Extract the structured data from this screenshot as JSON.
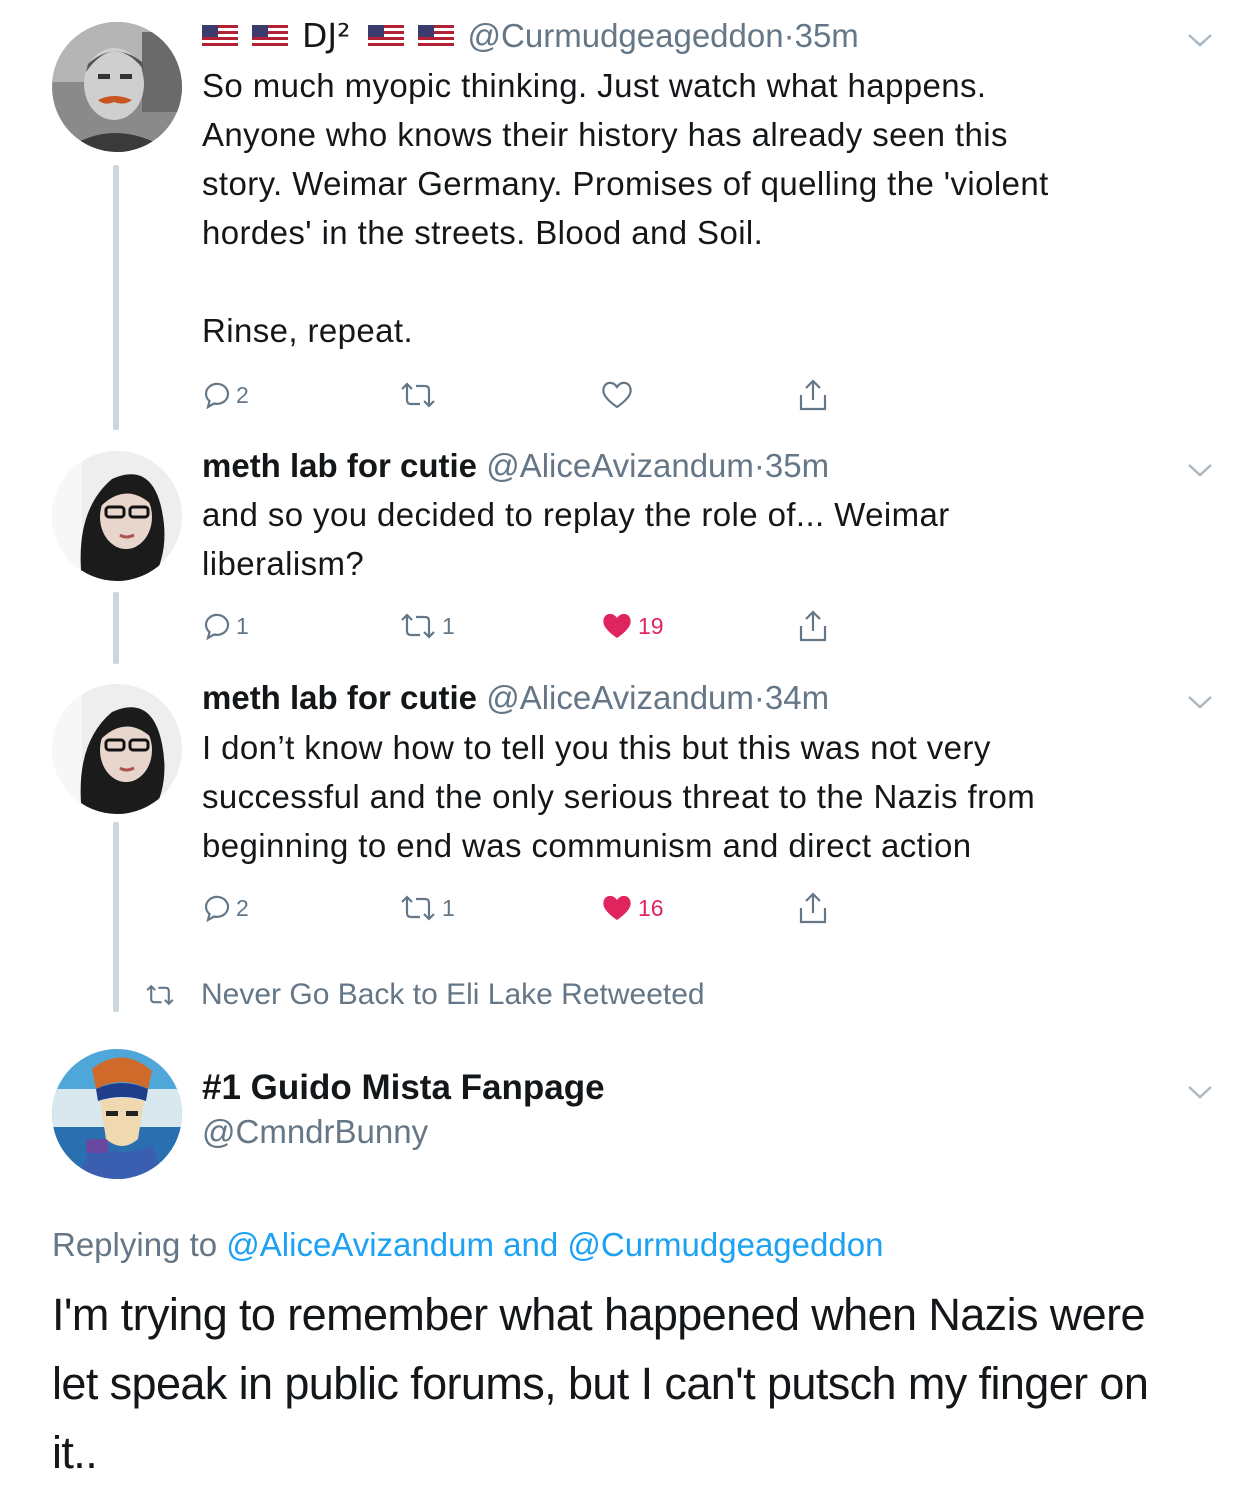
{
  "colors": {
    "accent": "#1da1f2",
    "secondary_text": "#657786",
    "like_red": "#e0245e",
    "thread_line": "#ccd6dd"
  },
  "tweets": [
    {
      "name_prefix_flags": 2,
      "name": "DJ²",
      "name_suffix_flags": 2,
      "handle": "@Curmudgeageddon",
      "separator": "·",
      "time": "35m",
      "lines": [
        "So much myopic thinking. Just watch what happens.",
        "Anyone who knows their history has already seen this",
        "story. Weimar Germany. Promises of quelling the 'violent",
        "hordes' in the streets. Blood and Soil.",
        "",
        "Rinse, repeat."
      ],
      "replies": "2",
      "retweets": "",
      "likes": "",
      "liked": false,
      "avatar_icon": "user-avatar-mustache"
    },
    {
      "name": "meth lab for cutie",
      "handle": "@AliceAvizandum",
      "separator": "·",
      "time": "35m",
      "lines": [
        "and so you decided to replay the role of... Weimar",
        "liberalism?"
      ],
      "replies": "1",
      "retweets": "1",
      "likes": "19",
      "liked": true,
      "avatar_icon": "user-avatar-hijab"
    },
    {
      "name": "meth lab for cutie",
      "handle": "@AliceAvizandum",
      "separator": "·",
      "time": "34m",
      "lines": [
        "I don’t know how to tell you this but this was not very",
        "successful and the only serious threat to the Nazis from",
        "beginning to end was communism and direct action"
      ],
      "replies": "2",
      "retweets": "1",
      "likes": "16",
      "liked": true,
      "avatar_icon": "user-avatar-hijab"
    }
  ],
  "retweet_notice": "Never Go Back to Eli Lake Retweeted",
  "main_tweet": {
    "name": "#1 Guido Mista Fanpage",
    "handle": "@CmndrBunny",
    "replying_prefix": "Replying to",
    "mention1": "@AliceAvizandum",
    "and": "and",
    "mention2": "@Curmudgeageddon",
    "text_lines": [
      "I'm trying to remember what happened when Nazis were",
      "let speak in public forums, but I can't putsch my finger on",
      "it.."
    ],
    "avatar_icon": "user-avatar-anime"
  }
}
